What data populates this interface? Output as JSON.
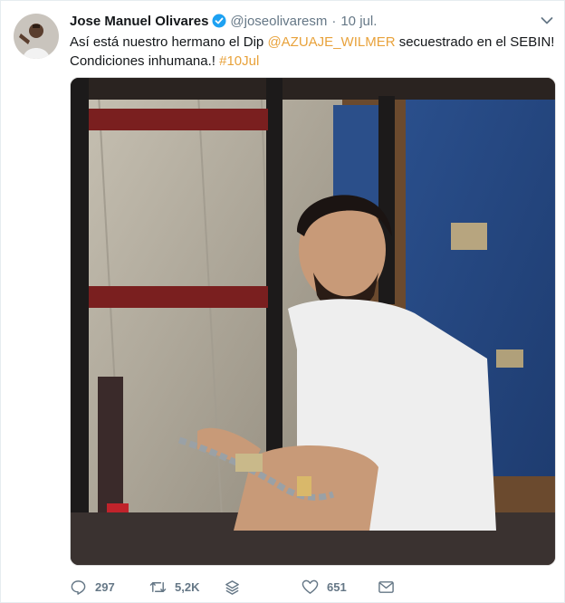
{
  "tweet": {
    "author_name": "Jose Manuel Olivares",
    "handle": "@joseolivaresm",
    "separator": "·",
    "time": "10 jul.",
    "text_before": "Así está nuestro hermano el Dip ",
    "mention": "@AZUAJE_WILMER",
    "text_middle": " secuestrado en el SEBIN! Condiciones inhumana.! ",
    "hashtag": "#10Jul"
  },
  "actions": {
    "replies": "297",
    "retweets": "5,2K",
    "likes": "651"
  },
  "colors": {
    "link": "#e8a23b",
    "verified": "#1da1f2",
    "muted": "#657786"
  },
  "icons": {
    "reply": "reply-icon",
    "retweet": "retweet-icon",
    "stack": "stack-icon",
    "like": "heart-icon",
    "dm": "envelope-icon",
    "menu": "chevron-down-icon"
  }
}
